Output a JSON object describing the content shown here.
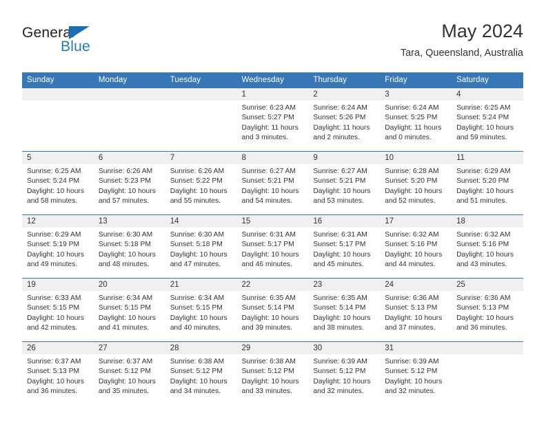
{
  "brand": {
    "name_part1": "General",
    "name_part2": "Blue",
    "triangle_icon": "triangle-icon",
    "color_dark": "#231f20",
    "color_blue": "#1f7ac0"
  },
  "header": {
    "title": "May 2024",
    "location": "Tara, Queensland, Australia"
  },
  "theme": {
    "header_bg": "#3877b6",
    "daynum_bg": "#f0f0f0",
    "text": "#333333"
  },
  "weekday_headers": [
    "Sunday",
    "Monday",
    "Tuesday",
    "Wednesday",
    "Thursday",
    "Friday",
    "Saturday"
  ],
  "weeks": [
    [
      {
        "day": "",
        "sunrise": "",
        "sunset": "",
        "daylight_line1": "",
        "daylight_line2": ""
      },
      {
        "day": "",
        "sunrise": "",
        "sunset": "",
        "daylight_line1": "",
        "daylight_line2": ""
      },
      {
        "day": "",
        "sunrise": "",
        "sunset": "",
        "daylight_line1": "",
        "daylight_line2": ""
      },
      {
        "day": "1",
        "sunrise": "Sunrise: 6:23 AM",
        "sunset": "Sunset: 5:27 PM",
        "daylight_line1": "Daylight: 11 hours",
        "daylight_line2": "and 3 minutes."
      },
      {
        "day": "2",
        "sunrise": "Sunrise: 6:24 AM",
        "sunset": "Sunset: 5:26 PM",
        "daylight_line1": "Daylight: 11 hours",
        "daylight_line2": "and 2 minutes."
      },
      {
        "day": "3",
        "sunrise": "Sunrise: 6:24 AM",
        "sunset": "Sunset: 5:25 PM",
        "daylight_line1": "Daylight: 11 hours",
        "daylight_line2": "and 0 minutes."
      },
      {
        "day": "4",
        "sunrise": "Sunrise: 6:25 AM",
        "sunset": "Sunset: 5:24 PM",
        "daylight_line1": "Daylight: 10 hours",
        "daylight_line2": "and 59 minutes."
      }
    ],
    [
      {
        "day": "5",
        "sunrise": "Sunrise: 6:25 AM",
        "sunset": "Sunset: 5:24 PM",
        "daylight_line1": "Daylight: 10 hours",
        "daylight_line2": "and 58 minutes."
      },
      {
        "day": "6",
        "sunrise": "Sunrise: 6:26 AM",
        "sunset": "Sunset: 5:23 PM",
        "daylight_line1": "Daylight: 10 hours",
        "daylight_line2": "and 57 minutes."
      },
      {
        "day": "7",
        "sunrise": "Sunrise: 6:26 AM",
        "sunset": "Sunset: 5:22 PM",
        "daylight_line1": "Daylight: 10 hours",
        "daylight_line2": "and 55 minutes."
      },
      {
        "day": "8",
        "sunrise": "Sunrise: 6:27 AM",
        "sunset": "Sunset: 5:21 PM",
        "daylight_line1": "Daylight: 10 hours",
        "daylight_line2": "and 54 minutes."
      },
      {
        "day": "9",
        "sunrise": "Sunrise: 6:27 AM",
        "sunset": "Sunset: 5:21 PM",
        "daylight_line1": "Daylight: 10 hours",
        "daylight_line2": "and 53 minutes."
      },
      {
        "day": "10",
        "sunrise": "Sunrise: 6:28 AM",
        "sunset": "Sunset: 5:20 PM",
        "daylight_line1": "Daylight: 10 hours",
        "daylight_line2": "and 52 minutes."
      },
      {
        "day": "11",
        "sunrise": "Sunrise: 6:29 AM",
        "sunset": "Sunset: 5:20 PM",
        "daylight_line1": "Daylight: 10 hours",
        "daylight_line2": "and 51 minutes."
      }
    ],
    [
      {
        "day": "12",
        "sunrise": "Sunrise: 6:29 AM",
        "sunset": "Sunset: 5:19 PM",
        "daylight_line1": "Daylight: 10 hours",
        "daylight_line2": "and 49 minutes."
      },
      {
        "day": "13",
        "sunrise": "Sunrise: 6:30 AM",
        "sunset": "Sunset: 5:18 PM",
        "daylight_line1": "Daylight: 10 hours",
        "daylight_line2": "and 48 minutes."
      },
      {
        "day": "14",
        "sunrise": "Sunrise: 6:30 AM",
        "sunset": "Sunset: 5:18 PM",
        "daylight_line1": "Daylight: 10 hours",
        "daylight_line2": "and 47 minutes."
      },
      {
        "day": "15",
        "sunrise": "Sunrise: 6:31 AM",
        "sunset": "Sunset: 5:17 PM",
        "daylight_line1": "Daylight: 10 hours",
        "daylight_line2": "and 46 minutes."
      },
      {
        "day": "16",
        "sunrise": "Sunrise: 6:31 AM",
        "sunset": "Sunset: 5:17 PM",
        "daylight_line1": "Daylight: 10 hours",
        "daylight_line2": "and 45 minutes."
      },
      {
        "day": "17",
        "sunrise": "Sunrise: 6:32 AM",
        "sunset": "Sunset: 5:16 PM",
        "daylight_line1": "Daylight: 10 hours",
        "daylight_line2": "and 44 minutes."
      },
      {
        "day": "18",
        "sunrise": "Sunrise: 6:32 AM",
        "sunset": "Sunset: 5:16 PM",
        "daylight_line1": "Daylight: 10 hours",
        "daylight_line2": "and 43 minutes."
      }
    ],
    [
      {
        "day": "19",
        "sunrise": "Sunrise: 6:33 AM",
        "sunset": "Sunset: 5:15 PM",
        "daylight_line1": "Daylight: 10 hours",
        "daylight_line2": "and 42 minutes."
      },
      {
        "day": "20",
        "sunrise": "Sunrise: 6:34 AM",
        "sunset": "Sunset: 5:15 PM",
        "daylight_line1": "Daylight: 10 hours",
        "daylight_line2": "and 41 minutes."
      },
      {
        "day": "21",
        "sunrise": "Sunrise: 6:34 AM",
        "sunset": "Sunset: 5:15 PM",
        "daylight_line1": "Daylight: 10 hours",
        "daylight_line2": "and 40 minutes."
      },
      {
        "day": "22",
        "sunrise": "Sunrise: 6:35 AM",
        "sunset": "Sunset: 5:14 PM",
        "daylight_line1": "Daylight: 10 hours",
        "daylight_line2": "and 39 minutes."
      },
      {
        "day": "23",
        "sunrise": "Sunrise: 6:35 AM",
        "sunset": "Sunset: 5:14 PM",
        "daylight_line1": "Daylight: 10 hours",
        "daylight_line2": "and 38 minutes."
      },
      {
        "day": "24",
        "sunrise": "Sunrise: 6:36 AM",
        "sunset": "Sunset: 5:13 PM",
        "daylight_line1": "Daylight: 10 hours",
        "daylight_line2": "and 37 minutes."
      },
      {
        "day": "25",
        "sunrise": "Sunrise: 6:36 AM",
        "sunset": "Sunset: 5:13 PM",
        "daylight_line1": "Daylight: 10 hours",
        "daylight_line2": "and 36 minutes."
      }
    ],
    [
      {
        "day": "26",
        "sunrise": "Sunrise: 6:37 AM",
        "sunset": "Sunset: 5:13 PM",
        "daylight_line1": "Daylight: 10 hours",
        "daylight_line2": "and 36 minutes."
      },
      {
        "day": "27",
        "sunrise": "Sunrise: 6:37 AM",
        "sunset": "Sunset: 5:12 PM",
        "daylight_line1": "Daylight: 10 hours",
        "daylight_line2": "and 35 minutes."
      },
      {
        "day": "28",
        "sunrise": "Sunrise: 6:38 AM",
        "sunset": "Sunset: 5:12 PM",
        "daylight_line1": "Daylight: 10 hours",
        "daylight_line2": "and 34 minutes."
      },
      {
        "day": "29",
        "sunrise": "Sunrise: 6:38 AM",
        "sunset": "Sunset: 5:12 PM",
        "daylight_line1": "Daylight: 10 hours",
        "daylight_line2": "and 33 minutes."
      },
      {
        "day": "30",
        "sunrise": "Sunrise: 6:39 AM",
        "sunset": "Sunset: 5:12 PM",
        "daylight_line1": "Daylight: 10 hours",
        "daylight_line2": "and 32 minutes."
      },
      {
        "day": "31",
        "sunrise": "Sunrise: 6:39 AM",
        "sunset": "Sunset: 5:12 PM",
        "daylight_line1": "Daylight: 10 hours",
        "daylight_line2": "and 32 minutes."
      },
      {
        "day": "",
        "sunrise": "",
        "sunset": "",
        "daylight_line1": "",
        "daylight_line2": ""
      }
    ]
  ]
}
